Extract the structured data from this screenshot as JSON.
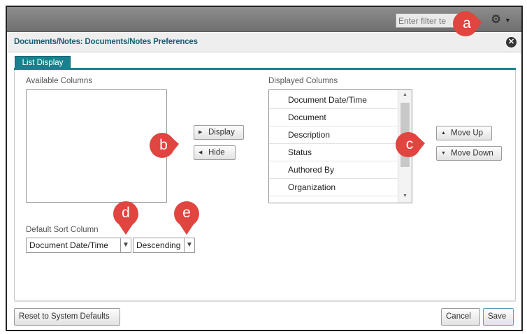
{
  "topbar": {
    "filter_placeholder": "Enter filter te"
  },
  "dialog": {
    "title": "Documents/Notes: Documents/Notes Preferences",
    "tab_label": "List Display"
  },
  "available": {
    "label": "Available Columns"
  },
  "buttons": {
    "display": "Display",
    "hide": "Hide",
    "move_up": "Move Up",
    "move_down": "Move Down",
    "reset": "Reset to System Defaults",
    "cancel": "Cancel",
    "save": "Save"
  },
  "displayed": {
    "label": "Displayed Columns",
    "items": [
      "Document Date/Time",
      "Document",
      "Description",
      "Status",
      "Authored By",
      "Organization"
    ]
  },
  "sort": {
    "label": "Default Sort Column",
    "column": "Document Date/Time",
    "order": "Descending"
  },
  "markers": [
    "a",
    "b",
    "c",
    "d",
    "e"
  ],
  "colors": {
    "accent": "#19818e",
    "marker": "#e0453f",
    "title": "#1c5f74"
  },
  "icons": [
    "gear-icon",
    "close-icon",
    "caret-right-icon",
    "caret-left-icon",
    "caret-up-icon",
    "caret-down-icon",
    "chevron-down-icon"
  ]
}
